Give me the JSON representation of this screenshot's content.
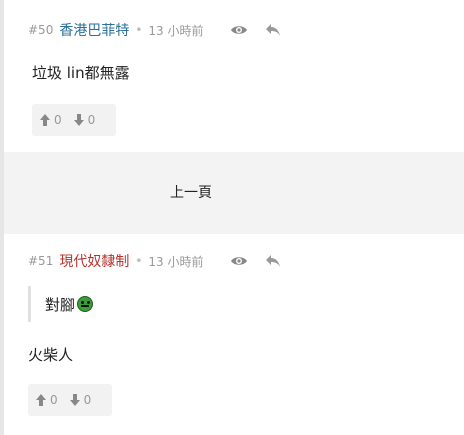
{
  "posts": [
    {
      "number": "#50",
      "username": "香港巴菲特",
      "username_color": "#2b6f9b",
      "separator": "•",
      "time": "13 小時前",
      "content": "垃圾 lin都無露",
      "upvotes": "0",
      "downvotes": "0"
    },
    {
      "number": "#51",
      "username": "現代奴隸制",
      "username_color": "#b8322c",
      "separator": "•",
      "time": "13 小時前",
      "quote": "對腳",
      "quote_emoji": "green-smiley-emoji",
      "content": "火柴人",
      "upvotes": "0",
      "downvotes": "0"
    }
  ],
  "pager": {
    "prev_label": "上一頁"
  },
  "icons": {
    "view": "eye-icon",
    "reply": "reply-arrow-icon",
    "up": "thumb-up-arrow-icon",
    "down": "thumb-down-arrow-icon"
  }
}
